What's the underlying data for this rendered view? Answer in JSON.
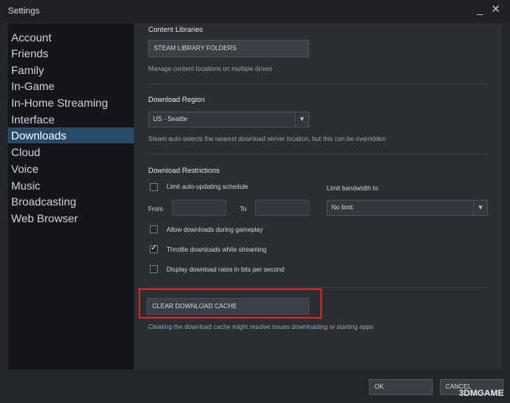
{
  "window": {
    "title": "Settings",
    "minimize_glyph": "_",
    "close_glyph": "✕"
  },
  "sidebar": {
    "items": [
      {
        "label": "Account"
      },
      {
        "label": "Friends"
      },
      {
        "label": "Family"
      },
      {
        "label": "In-Game"
      },
      {
        "label": "In-Home Streaming"
      },
      {
        "label": "Interface"
      },
      {
        "label": "Downloads"
      },
      {
        "label": "Cloud"
      },
      {
        "label": "Voice"
      },
      {
        "label": "Music"
      },
      {
        "label": "Broadcasting"
      },
      {
        "label": "Web Browser"
      }
    ],
    "active_index": 6
  },
  "content": {
    "content_libraries": {
      "title": "Content Libraries",
      "button": "STEAM LIBRARY FOLDERS",
      "desc": "Manage content locations on multiple drives"
    },
    "download_region": {
      "title": "Download Region",
      "selected": "US - Seattle",
      "desc": "Steam auto-selects the nearest download server location, but this can be overridden"
    },
    "download_restrictions": {
      "title": "Download Restrictions",
      "limit_auto_update": "Limit auto-updating schedule",
      "from_label": "From",
      "to_label": "To",
      "bandwidth_label": "Limit bandwidth to",
      "bandwidth_selected": "No limit",
      "allow_gameplay": "Allow downloads during gameplay",
      "throttle_streaming": "Throttle downloads while streaming",
      "display_bits": "Display download rates in bits per second"
    },
    "cache": {
      "button": "CLEAR DOWNLOAD CACHE",
      "desc": "Clearing the download cache might resolve issues downloading or starting apps"
    }
  },
  "footer": {
    "ok": "OK",
    "cancel": "CANCEL"
  },
  "watermark": "3DMGAME",
  "colors": {
    "accent": "#2a4a6a",
    "highlight": "#e02424"
  }
}
